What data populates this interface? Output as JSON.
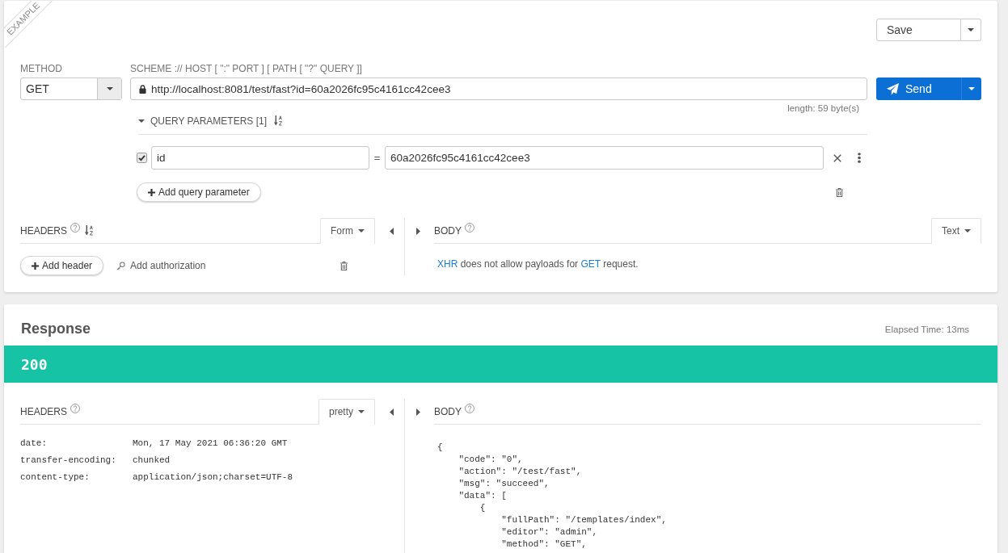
{
  "ribbon": {
    "label": "EXAMPLE"
  },
  "request": {
    "save": {
      "label": "Save"
    },
    "method": {
      "label": "METHOD",
      "value": "GET"
    },
    "url": {
      "label": "SCHEME :// HOST [ \":\" PORT ] [ PATH [ \"?\" QUERY ]]",
      "value": "http://localhost:8081/test/fast?id=60a2026fc95c4161cc42cee3",
      "length": "length: 59 byte(s)"
    },
    "send": {
      "label": "Send"
    },
    "query": {
      "title": "QUERY PARAMETERS [1]",
      "expanded": true,
      "params": [
        {
          "checked": true,
          "name": "id",
          "operator": "=",
          "value": "60a2026fc95c4161cc42cee3"
        }
      ],
      "add_button": "Add query parameter"
    },
    "headers": {
      "title": "HEADERS",
      "editor": "Form",
      "add_header": "Add header",
      "add_authorization": "Add authorization"
    },
    "body": {
      "title": "BODY",
      "editor": "Text",
      "note": [
        {
          "kind": "code",
          "text": "XHR"
        },
        {
          "kind": "plain",
          "text": " does not allow payloads for "
        },
        {
          "kind": "code",
          "text": "GET"
        },
        {
          "kind": "plain",
          "text": " request."
        }
      ]
    }
  },
  "response": {
    "title": "Response",
    "elapsed": "Elapsed Time: 13ms",
    "status": "200",
    "headers": {
      "title": "HEADERS",
      "view": "pretty",
      "rows": [
        {
          "name": "date:",
          "value": "Mon, 17 May 2021 06:36:20 GMT"
        },
        {
          "name": "transfer-encoding:",
          "value": "chunked"
        },
        {
          "name": "content-type:",
          "value": "application/json;charset=UTF-8"
        }
      ]
    },
    "body": {
      "title": "BODY",
      "lines": [
        "{",
        "    \"code\": \"0\",",
        "    \"action\": \"/test/fast\",",
        "    \"msg\": \"succeed\",",
        "    \"data\": [",
        "        {",
        "            \"fullPath\": \"/templates/index\",",
        "            \"editor\": \"admin\",",
        "            \"method\": \"GET\","
      ]
    }
  }
}
